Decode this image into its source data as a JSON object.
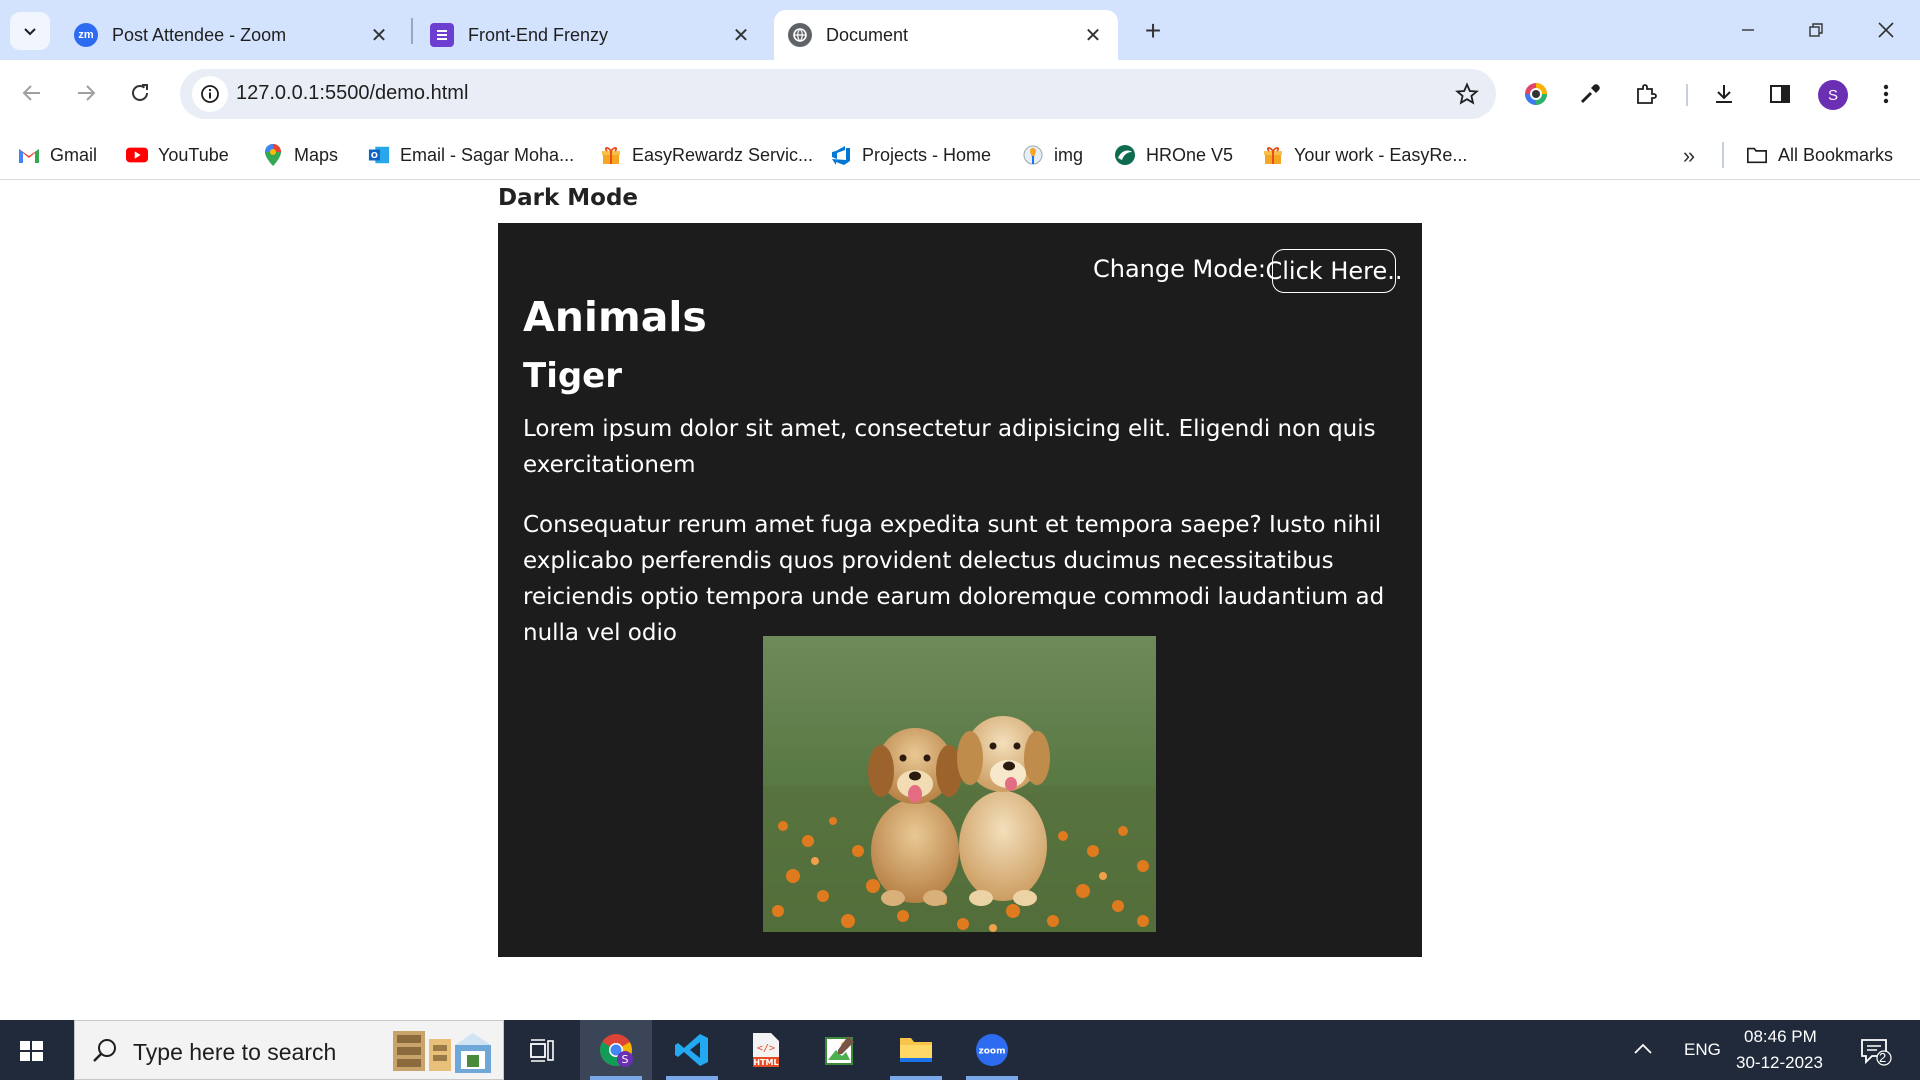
{
  "browser": {
    "tabs": [
      {
        "title": "Post Attendee - Zoom",
        "favicon": "zoom-icon"
      },
      {
        "title": "Front-End Frenzy",
        "favicon": "forms-icon"
      },
      {
        "title": "Document",
        "favicon": "globe-icon",
        "active": true
      }
    ],
    "address": {
      "url": "127.0.0.1:5500/demo.html"
    },
    "profile_initial": "S",
    "bookmarks": [
      {
        "label": "Gmail",
        "icon": "gmail-icon"
      },
      {
        "label": "YouTube",
        "icon": "youtube-icon"
      },
      {
        "label": "Maps",
        "icon": "maps-icon"
      },
      {
        "label": "Email - Sagar Moha...",
        "icon": "outlook-icon"
      },
      {
        "label": "EasyRewardz Servic...",
        "icon": "easyrewardz-icon"
      },
      {
        "label": "Projects - Home",
        "icon": "azure-devops-icon"
      },
      {
        "label": "img",
        "icon": "img-icon"
      },
      {
        "label": "HROne V5",
        "icon": "hrone-icon"
      },
      {
        "label": "Your work - EasyRe...",
        "icon": "easyrewardz-icon"
      }
    ],
    "all_bookmarks_label": "All Bookmarks"
  },
  "page": {
    "top_heading": "Dark Mode",
    "change_mode_label": "Change Mode:",
    "change_mode_button": "Click Here..",
    "h1": "Animals",
    "h2": "Tiger",
    "paragraphs": [
      "Lorem ipsum dolor sit amet, consectetur adipisicing elit. Eligendi non quis exercitationem",
      "Consequatur rerum amet fuga expedita sunt et tempora saepe? Iusto nihil explicabo perferendis quos provident delectus ducimus necessitatibus reiciendis optio tempora unde earum doloremque commodi laudantium ad nulla vel odio"
    ],
    "card_bg": "#1c1c1c"
  },
  "taskbar": {
    "search_placeholder": "Type here to search",
    "language": "ENG",
    "time": "08:46 PM",
    "date": "30-12-2023",
    "notification_count": "2"
  }
}
